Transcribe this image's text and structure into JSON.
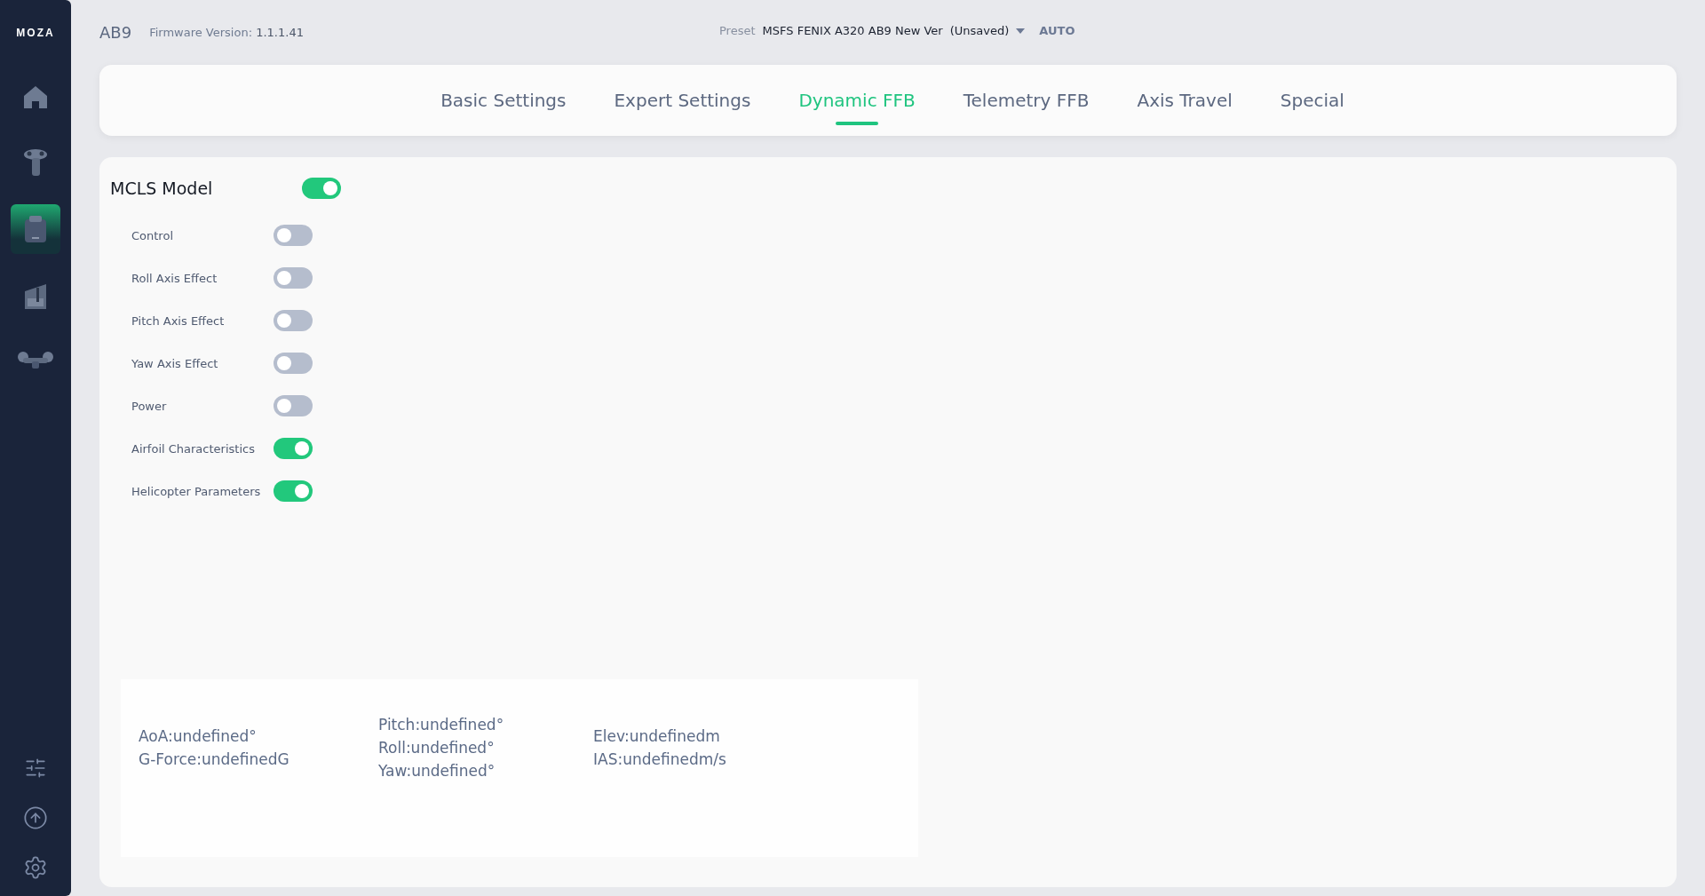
{
  "sidebar": {
    "logo": "MOZA",
    "items": [
      {
        "kind": "home",
        "selected": false
      },
      {
        "kind": "joystick",
        "selected": false
      },
      {
        "kind": "base",
        "selected": true
      },
      {
        "kind": "throttle",
        "selected": false
      },
      {
        "kind": "drone",
        "selected": false
      }
    ],
    "bottom": [
      {
        "kind": "sliders"
      },
      {
        "kind": "upload"
      },
      {
        "kind": "settings"
      }
    ]
  },
  "header": {
    "device": "AB9",
    "firmware_label": "Firmware Version:",
    "firmware": "1.1.1.41",
    "preset_label": "Preset",
    "preset": "MSFS FENIX A320 AB9 New Ver",
    "preset_state": "(Unsaved)",
    "mode": "AUTO"
  },
  "tabs": [
    {
      "label": "Basic Settings",
      "selected": false
    },
    {
      "label": "Expert Settings",
      "selected": false
    },
    {
      "label": "Dynamic FFB",
      "selected": true
    },
    {
      "label": "Telemetry FFB",
      "selected": false
    },
    {
      "label": "Axis Travel",
      "selected": false
    },
    {
      "label": "Special",
      "selected": false
    }
  ],
  "mcls": {
    "title": "MCLS Model",
    "on": true
  },
  "toggles": [
    {
      "label": "Control",
      "on": false
    },
    {
      "label": "Roll Axis Effect",
      "on": false
    },
    {
      "label": "Pitch Axis Effect",
      "on": false
    },
    {
      "label": "Yaw Axis Effect",
      "on": false
    },
    {
      "label": "Power",
      "on": false
    },
    {
      "label": "Airfoil Characteristics",
      "on": true
    },
    {
      "label": "Helicopter Parameters",
      "on": true
    }
  ],
  "telemetry": [
    [
      "AoA:undefined°",
      "G-Force:undefinedG"
    ],
    [
      "Pitch:undefined°",
      "Roll:undefined°",
      "Yaw:undefined°"
    ],
    [
      "Elev:undefinedm",
      "IAS:undefinedm/s"
    ]
  ]
}
